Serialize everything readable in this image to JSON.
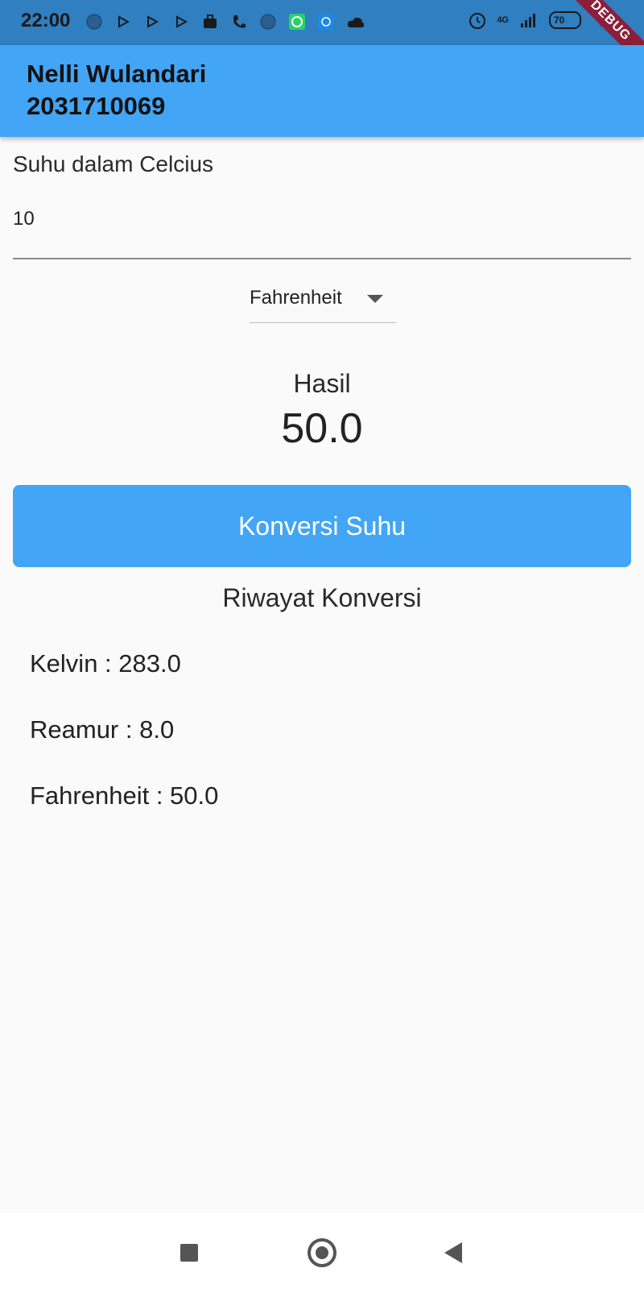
{
  "status_bar": {
    "time": "22:00",
    "network": "4G",
    "battery": "70",
    "debug_banner": "DEBUG"
  },
  "app_bar": {
    "name": "Nelli Wulandari",
    "student_id": "2031710069"
  },
  "input": {
    "label": "Suhu dalam Celcius",
    "value": "10"
  },
  "dropdown": {
    "selected": "Fahrenheit"
  },
  "result": {
    "title": "Hasil",
    "value": "50.0"
  },
  "convert_button": {
    "label": "Konversi Suhu"
  },
  "history": {
    "title": "Riwayat Konversi",
    "items": [
      "Kelvin : 283.0",
      "Reamur : 8.0",
      "Fahrenheit : 50.0"
    ]
  },
  "colors": {
    "primary": "#42a5f5",
    "status_bar": "#2f7fc1",
    "background": "#fafafa"
  }
}
